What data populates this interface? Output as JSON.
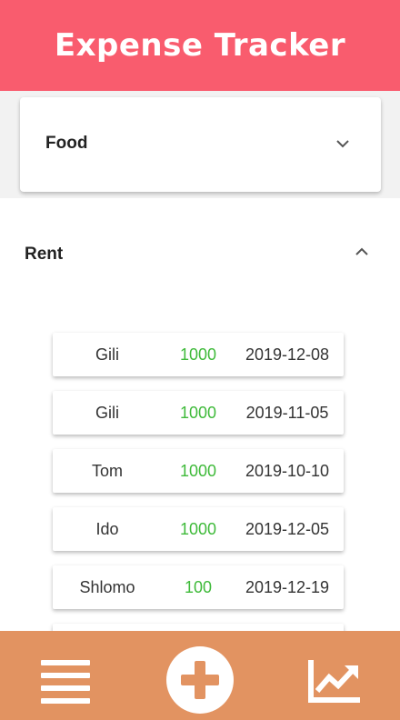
{
  "app": {
    "title": "Expense Tracker"
  },
  "categories": {
    "collapsed": {
      "label": "Food"
    },
    "expanded": {
      "label": "Rent",
      "expenses": [
        {
          "name": "Gili",
          "amount": "1000",
          "date": "2019-12-08"
        },
        {
          "name": "Gili",
          "amount": "1000",
          "date": "2019-11-05"
        },
        {
          "name": "Tom",
          "amount": "1000",
          "date": "2019-10-10"
        },
        {
          "name": "Ido",
          "amount": "1000",
          "date": "2019-12-05"
        },
        {
          "name": "Shlomo",
          "amount": "100",
          "date": "2019-12-19"
        }
      ]
    }
  },
  "bottom_nav": {
    "icons": [
      "menu-icon",
      "add-icon",
      "chart-icon"
    ]
  },
  "colors": {
    "header": "#f95c6e",
    "footer": "#e29361",
    "amount": "#3fba3a"
  }
}
